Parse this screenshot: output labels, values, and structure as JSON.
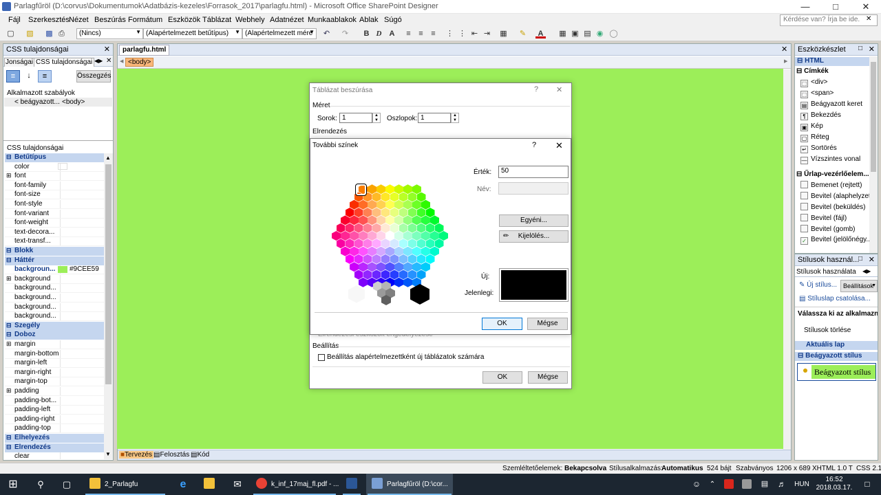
{
  "window": {
    "title": "Parlagfűröl (D:\\corvus\\Dokumentumok\\Adatbázis-kezeles\\Forrasok_2017\\parlagfu.html) - Microsoft Office SharePoint Designer"
  },
  "menu": {
    "items": [
      "Fájl",
      "Szerkesztés",
      "Nézet",
      "Beszúrás",
      "Formátum",
      "Eszközök",
      "Táblázat",
      "Webhely",
      "Adatnézet",
      "Munkaablakok",
      "Ablak",
      "Súgó"
    ],
    "help_placeholder": "Kérdése van? Írja be ide."
  },
  "toolbar": {
    "style_combo": "(Nincs)",
    "font_combo": "(Alapértelmezett betűtípus)",
    "size_combo": "(Alapértelmezett mére"
  },
  "css_panel": {
    "title": "CSS tulajdonságai",
    "tab1": "Jonságai",
    "tab2": "CSS tulajdonságai",
    "summary_btn": "Összegzés",
    "applied_rules_label": "Alkalmazott szabályok",
    "applied_rule_name": "< beágyazott...",
    "applied_rule_tag": "<body>",
    "props_label": "CSS tulajdonságai",
    "rows": [
      {
        "name": "Betűtípus",
        "cat": true
      },
      {
        "name": "color"
      },
      {
        "name": "font",
        "plus": true
      },
      {
        "name": "font-family"
      },
      {
        "name": "font-size"
      },
      {
        "name": "font-style"
      },
      {
        "name": "font-variant"
      },
      {
        "name": "font-weight"
      },
      {
        "name": "text-decora..."
      },
      {
        "name": "text-transf..."
      },
      {
        "name": "Blokk",
        "cat": true
      },
      {
        "name": "Háttér",
        "cat": true
      },
      {
        "name": "backgroun...",
        "bold": true,
        "value": "#9CEE59",
        "swatch": "#9CEE59"
      },
      {
        "name": "background",
        "plus": true
      },
      {
        "name": "background..."
      },
      {
        "name": "background..."
      },
      {
        "name": "background..."
      },
      {
        "name": "background..."
      },
      {
        "name": "Szegély",
        "cat": true
      },
      {
        "name": "Doboz",
        "cat": true
      },
      {
        "name": "margin",
        "plus": true
      },
      {
        "name": "margin-bottom"
      },
      {
        "name": "margin-left"
      },
      {
        "name": "margin-right"
      },
      {
        "name": "margin-top"
      },
      {
        "name": "padding",
        "plus": true
      },
      {
        "name": "padding-bot..."
      },
      {
        "name": "padding-left"
      },
      {
        "name": "padding-right"
      },
      {
        "name": "padding-top"
      },
      {
        "name": "Elhelyezés",
        "cat": true
      },
      {
        "name": "Elrendezés",
        "cat": true
      },
      {
        "name": "clear"
      }
    ]
  },
  "doc": {
    "tab": "parlagfu.html",
    "breadcrumb": "<body>",
    "views": [
      "Tervezés",
      "Felosztás",
      "Kód"
    ],
    "bg_color": "#9CEE59"
  },
  "table_dialog": {
    "title": "Táblázat beszúrása",
    "size_group": "Méret",
    "rows_label": "Sorok:",
    "rows_value": "1",
    "cols_label": "Oszlopok:",
    "cols_value": "1",
    "layout_group": "Elrendezés",
    "settings_group": "Beállítás",
    "default_check": "Beállítás alapértelmezettként új táblázatok számára",
    "hidden_text": "Elrendezési eszközök engedélyezése",
    "ok": "OK",
    "cancel": "Mégse"
  },
  "color_dialog": {
    "title": "További színek",
    "value_label": "Érték:",
    "value": "50",
    "name_label": "Név:",
    "custom_btn": "Egyéni...",
    "select_btn": "Kijelölés...",
    "new_label": "Új:",
    "current_label": "Jelenlegi:",
    "new_color": "#000000",
    "current_color": "#000000",
    "ok": "OK",
    "cancel": "Mégse"
  },
  "toolbox": {
    "title": "Eszközkészlet",
    "html": "HTML",
    "tags_cat": "Címkék",
    "tags": [
      "<div>",
      "<span>",
      "Beágyazott keret",
      "Bekezdés",
      "Kép",
      "Réteg",
      "Sortörés",
      "Vízszintes vonal"
    ],
    "form_cat": "Űrlap-vezérlőelem...",
    "forms": [
      "Bemenet (rejtett)",
      "Bevitel (alaphelyzet)",
      "Bevitel (beküldés)",
      "Bevitel (fájl)",
      "Bevitel (gomb)",
      "Bevitel (jelölőnégy..."
    ]
  },
  "styles_panel": {
    "title": "Stílusok használ...",
    "tab": "Stílusok használata",
    "new_style": "Új stílus...",
    "settings_btn": "Beállítások",
    "attach": "Stíluslap csatolása...",
    "choose": "Válassza ki az alkalmazni k",
    "delete": "Stílusok törlése",
    "current_page": "Aktuális lap",
    "embedded_cat": "Beágyazott stílus",
    "embedded_item": "Beágyazott stílus"
  },
  "statusbar": {
    "vis": "Szemléltetőelemek:",
    "vis_val": "Bekapcsolva",
    "style": "Stílusalkalmazás:",
    "style_val": "Automatikus",
    "size": "524 bájt",
    "standard": "Szabványos",
    "dims": "1206 x 689",
    "xhtml": "XHTML 1.0 T",
    "css": "CSS 2.1"
  },
  "taskbar": {
    "items": [
      "2_Parlagfu",
      "k_inf_17maj_fl.pdf - ...",
      "Parlagfűröl (D:\\cor..."
    ],
    "lang": "HUN",
    "time": "16:52",
    "date": "2018.03.17."
  }
}
